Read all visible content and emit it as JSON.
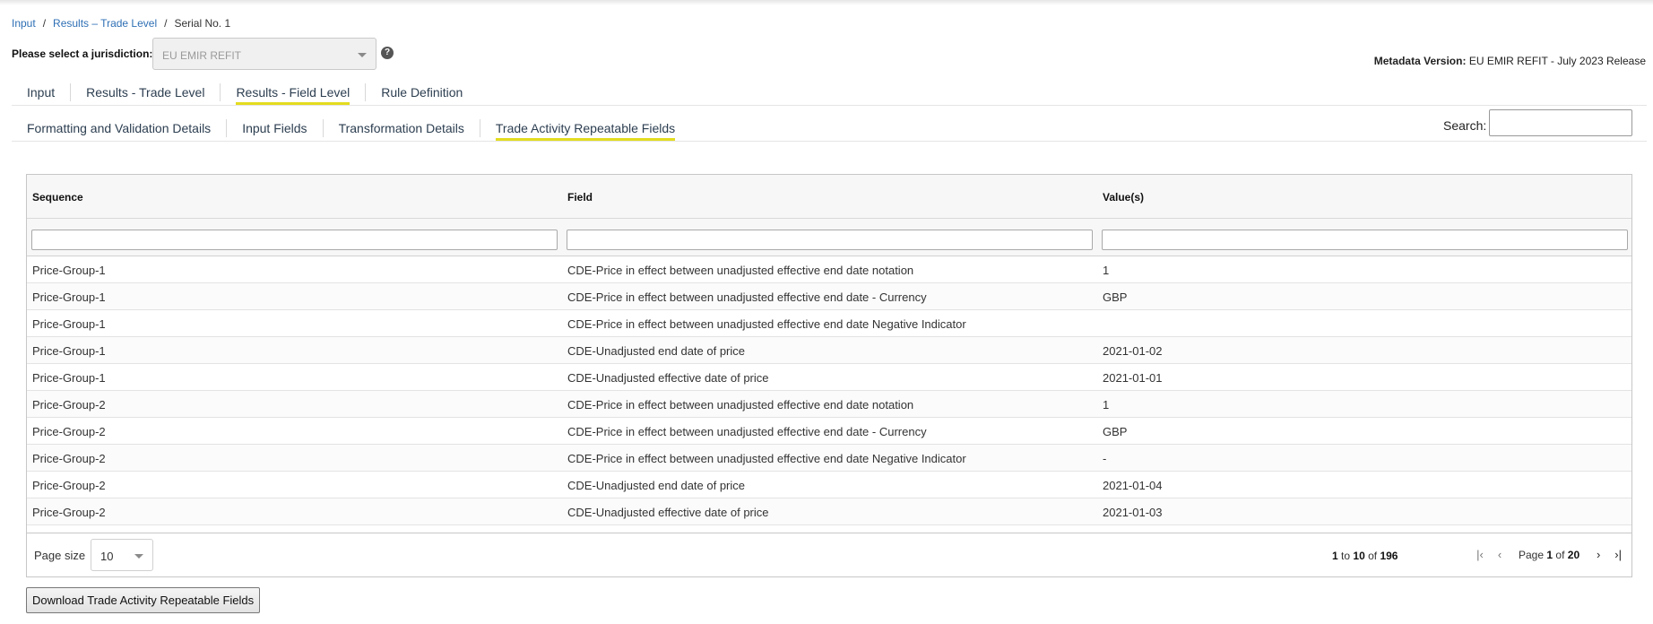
{
  "breadcrumb": {
    "items": [
      "Input",
      "Results – Trade Level"
    ],
    "current": "Serial No. 1",
    "separator": "/"
  },
  "jurisdiction": {
    "label": "Please select a jurisdiction:",
    "selected": "EU EMIR REFIT"
  },
  "metadata": {
    "label": "Metadata Version:",
    "value": "EU EMIR REFIT - July 2023 Release"
  },
  "main_tabs": [
    {
      "label": "Input",
      "active": false
    },
    {
      "label": "Results - Trade Level",
      "active": false
    },
    {
      "label": "Results - Field Level",
      "active": true
    },
    {
      "label": "Rule Definition",
      "active": false
    }
  ],
  "sub_tabs": [
    {
      "label": "Formatting and Validation Details",
      "active": false
    },
    {
      "label": "Input Fields",
      "active": false
    },
    {
      "label": "Transformation Details",
      "active": false
    },
    {
      "label": "Trade Activity Repeatable Fields",
      "active": true
    }
  ],
  "search": {
    "label": "Search:",
    "value": ""
  },
  "table": {
    "columns": [
      "Sequence",
      "Field",
      "Value(s)"
    ],
    "rows": [
      [
        "Price-Group-1",
        "CDE-Price in effect between unadjusted effective end date notation",
        "1"
      ],
      [
        "Price-Group-1",
        "CDE-Price in effect between unadjusted effective end date - Currency",
        "GBP"
      ],
      [
        "Price-Group-1",
        "CDE-Price in effect between unadjusted effective end date Negative Indicator",
        ""
      ],
      [
        "Price-Group-1",
        "CDE-Unadjusted end date of price",
        "2021-01-02"
      ],
      [
        "Price-Group-1",
        "CDE-Unadjusted effective date of price",
        "2021-01-01"
      ],
      [
        "Price-Group-2",
        "CDE-Price in effect between unadjusted effective end date notation",
        "1"
      ],
      [
        "Price-Group-2",
        "CDE-Price in effect between unadjusted effective end date - Currency",
        "GBP"
      ],
      [
        "Price-Group-2",
        "CDE-Price in effect between unadjusted effective end date Negative Indicator",
        "-"
      ],
      [
        "Price-Group-2",
        "CDE-Unadjusted end date of price",
        "2021-01-04"
      ],
      [
        "Price-Group-2",
        "CDE-Unadjusted effective date of price",
        "2021-01-03"
      ]
    ]
  },
  "pagination": {
    "page_size_label": "Page size",
    "page_size": "10",
    "from": "1",
    "to_word": "to",
    "to": "10",
    "of_word": "of",
    "total": "196",
    "page_word": "Page",
    "page": "1",
    "pages": "20"
  },
  "download_label": "Download Trade Activity Repeatable Fields",
  "icons": {
    "help": "question-circle-icon",
    "first": "first-page-icon",
    "prev": "prev-page-icon",
    "next": "next-page-icon",
    "last": "last-page-icon"
  },
  "colors": {
    "link": "#2e6fb4",
    "tab_underline": "#e3dc1f"
  }
}
